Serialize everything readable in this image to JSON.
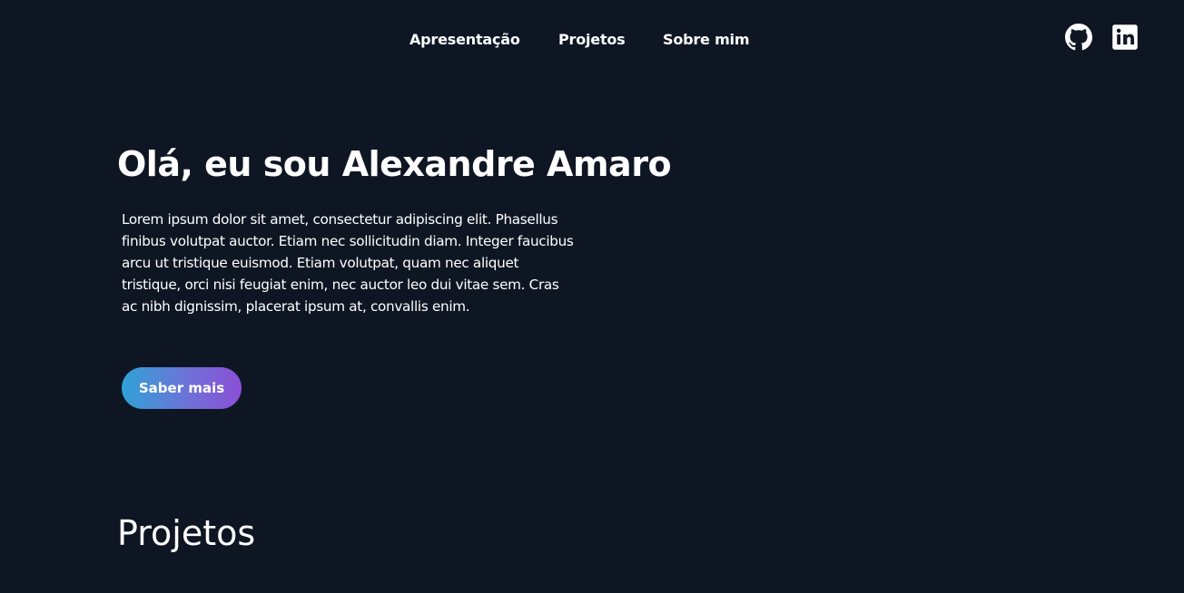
{
  "nav": {
    "items": [
      {
        "label": "Apresentação"
      },
      {
        "label": "Projetos"
      },
      {
        "label": "Sobre mim"
      }
    ],
    "social": [
      {
        "icon": "github-icon"
      },
      {
        "icon": "linkedin-icon"
      }
    ]
  },
  "hero": {
    "title": "Olá, eu sou Alexandre Amaro",
    "text": "Lorem ipsum dolor sit amet, consectetur adipiscing elit. Phasellus finibus volutpat auctor. Etiam nec sollicitudin diam. Integer faucibus arcu ut tristique euismod. Etiam volutpat, quam nec aliquet tristique, orci nisi feugiat enim, nec auctor leo dui vitae sem. Cras ac nibh dignissim, placerat ipsum at, convallis enim.",
    "cta_label": "Saber mais"
  },
  "projects": {
    "title": "Projetos"
  },
  "colors": {
    "background": "#0f1623",
    "text": "#ffffff",
    "gradient_start": "#2fa3d6",
    "gradient_end": "#8b4fd6"
  }
}
